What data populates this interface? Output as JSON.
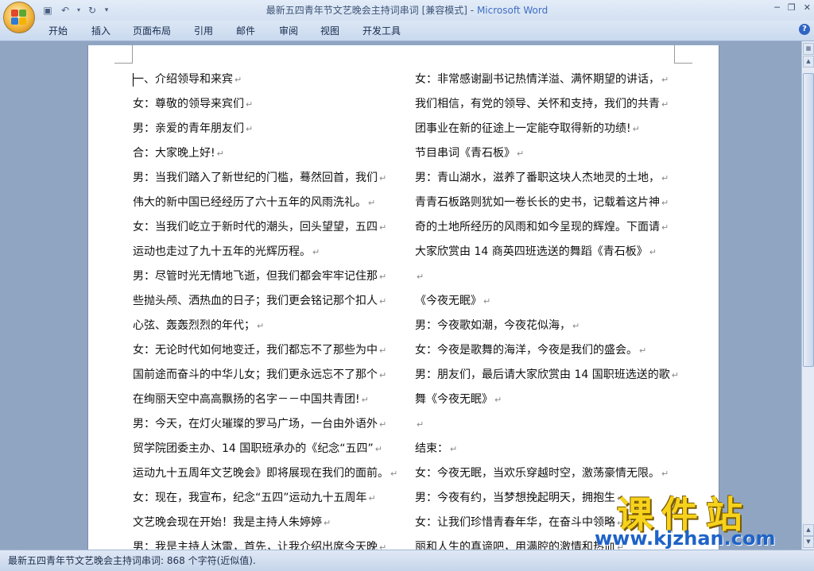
{
  "window": {
    "title": "最新五四青年节文艺晚会主持词串词 [兼容模式]",
    "separator": " - ",
    "app_name": "Microsoft Word"
  },
  "ribbon": {
    "tabs": [
      "开始",
      "插入",
      "页面布局",
      "引用",
      "邮件",
      "审阅",
      "视图",
      "开发工具"
    ]
  },
  "document": {
    "left_column": [
      "一、介绍领导和来宾",
      "女：尊敬的领导来宾们",
      "男：亲爱的青年朋友们",
      "合：大家晚上好!",
      "男：当我们踏入了新世纪的门槛，蓦然回首，我们",
      "伟大的新中国已经经历了六十五年的风雨洗礼。",
      "女：当我们屹立于新时代的潮头，回头望望，五四",
      "运动也走过了九十五年的光辉历程。",
      "男：尽管时光无情地飞逝，但我们都会牢牢记住那",
      "些抛头颅、洒热血的日子；我们更会铭记那个扣人",
      "心弦、轰轰烈烈的年代；",
      "女：无论时代如何地变迁，我们都忘不了那些为中",
      "国前途而奋斗的中华儿女；我们更永远忘不了那个",
      "在绚丽天空中高高飘扬的名字－－中国共青团!",
      "男：今天，在灯火璀璨的罗马广场，一台由外语外",
      "贸学院团委主办、14 国职班承办的《纪念“五四”",
      "运动九十五周年文艺晚会》即将展现在我们的面前。",
      "女：现在，我宣布，纪念“五四”运动九十五周年",
      "文艺晚会现在开始！我是主持人朱婷婷",
      "男：我是主持人沐雷，首先，让我介绍出席今天晚"
    ],
    "right_column": [
      "女：非常感谢副书记热情洋溢、满怀期望的讲话，",
      "我们相信，有党的领导、关怀和支持，我们的共青",
      "团事业在新的征途上一定能夺取得新的功绩!",
      "节目串词《青石板》",
      "男：青山湖水，滋养了番职这块人杰地灵的土地，",
      "青青石板路则犹如一卷长长的史书，记载着这片神",
      "奇的土地所经历的风雨和如今呈现的辉煌。下面请",
      "大家欣赏由 14 商英四班选送的舞蹈《青石板》",
      "",
      "《今夜无眠》",
      "男：今夜歌如潮，今夜花似海，",
      "女：今夜是歌舞的海洋，今夜是我们的盛会。",
      "男：朋友们，最后请大家欣赏由 14 国职班选送的歌",
      "舞《今夜无眠》",
      "",
      "结束：",
      "女：今夜无眠，当欢乐穿越时空，激荡豪情无限。",
      "男：今夜有约，当梦想挽起明天，拥抱生",
      "女：让我们珍惜青春年华，在奋斗中领略",
      "丽和人生的真谛吧，用满腔的激情和热血"
    ],
    "paragraph_mark": "↵"
  },
  "status_bar": {
    "text": "最新五四青年节文艺晚会主持词串词: 868 个字符(近似值)."
  },
  "watermark": {
    "title": "课件站",
    "url": "www.kjzhan.com"
  },
  "colors": {
    "app_name": "#3f6ec2",
    "watermark_title": "#f7d21b",
    "watermark_url": "#1e63c8"
  }
}
